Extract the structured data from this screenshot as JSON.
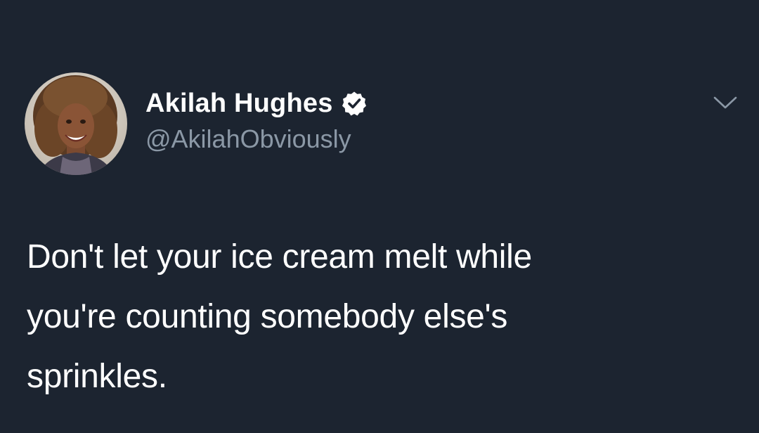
{
  "author": {
    "display_name": "Akilah Hughes",
    "handle": "@AkilahObviously",
    "verified": true,
    "avatar_icon": "profile-photo"
  },
  "tweet": {
    "lines": [
      "Don't let your ice cream melt while",
      "you're counting somebody else's",
      "sprinkles."
    ]
  },
  "menu": {
    "icon": "chevron-down-icon"
  },
  "colors": {
    "background": "#1c2430",
    "text": "#ffffff",
    "handle": "#8b98a6",
    "chevron": "#8b98a6"
  }
}
